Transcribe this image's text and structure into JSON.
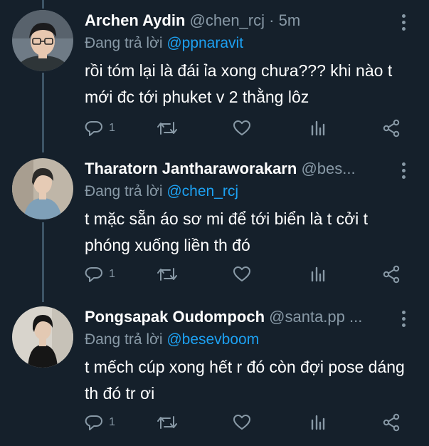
{
  "tweets": [
    {
      "name": "Archen Aydin",
      "handle": "@chen_rcj",
      "separator": "·",
      "time": "5m",
      "reply_prefix": "Đang trả lời",
      "reply_to": "@ppnaravit",
      "text": "rồi tóm lại là đái ỉa xong chưa??? khi nào t mới đc tới phuket v 2 thằng lôz",
      "reply_count": "1",
      "avatar_colors": {
        "bg": "#6f7b86",
        "skin": "#e8c8b0",
        "hair": "#1b1b1d",
        "shirt": "#2e3538"
      }
    },
    {
      "name": "Tharatorn Jantharaworakarn",
      "handle": "@bes...",
      "separator": "",
      "time": "",
      "reply_prefix": "Đang trả lời",
      "reply_to": "@chen_rcj",
      "text": "t mặc sẵn áo sơ mi để tới biển là t cởi t phóng xuống liền th đó",
      "reply_count": "1",
      "avatar_colors": {
        "bg": "#bfb6a8",
        "skin": "#e6cbb5",
        "hair": "#2b2a28",
        "shirt": "#7fa0b8"
      }
    },
    {
      "name": "Pongsapak Oudompoch",
      "handle": "@santa.pp ...",
      "separator": "",
      "time": "",
      "reply_prefix": "Đang trả lời",
      "reply_to": "@besevboom",
      "text": "t mếch cúp xong hết r đó còn đợi pose dáng th đó tr ơi",
      "reply_count": "1",
      "avatar_colors": {
        "bg": "#d8d4cc",
        "skin": "#e3c9b3",
        "hair": "#161616",
        "shirt": "#161616"
      }
    }
  ],
  "icons": {
    "reply": "reply-icon",
    "retweet": "retweet-icon",
    "like": "heart-icon",
    "analytics": "analytics-icon",
    "share": "share-icon",
    "more": "more-icon"
  },
  "colors": {
    "background": "#15202b",
    "text": "#ffffff",
    "muted": "#8899a6",
    "link": "#1da1f2",
    "thread_line": "#3d5466"
  }
}
